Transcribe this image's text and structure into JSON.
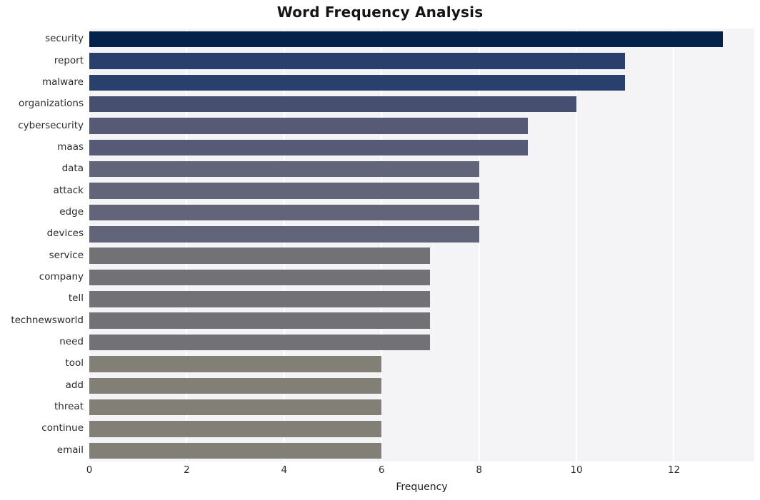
{
  "chart_data": {
    "type": "bar",
    "orientation": "horizontal",
    "title": "Word Frequency Analysis",
    "xlabel": "Frequency",
    "ylabel": "",
    "categories": [
      "security",
      "report",
      "malware",
      "organizations",
      "cybersecurity",
      "maas",
      "data",
      "attack",
      "edge",
      "devices",
      "service",
      "company",
      "tell",
      "technewsworld",
      "need",
      "tool",
      "add",
      "threat",
      "continue",
      "email"
    ],
    "values": [
      13,
      11,
      11,
      10,
      9,
      9,
      8,
      8,
      8,
      8,
      7,
      7,
      7,
      7,
      7,
      6,
      6,
      6,
      6,
      6
    ],
    "bar_colors": [
      "#04234a",
      "#293f6c",
      "#293f6c",
      "#474f70",
      "#565a76",
      "#565a76",
      "#62657a",
      "#62657a",
      "#62657a",
      "#62657a",
      "#727276",
      "#727276",
      "#727276",
      "#727276",
      "#727276",
      "#827f76",
      "#827f76",
      "#827f76",
      "#827f76",
      "#827f76"
    ],
    "xlim": [
      0,
      13.65
    ],
    "x_ticks": [
      0,
      2,
      4,
      6,
      8,
      10,
      12
    ],
    "x_tick_labels": [
      "0",
      "2",
      "4",
      "6",
      "8",
      "10",
      "12"
    ],
    "grid": true,
    "grid_axis": "x",
    "grid_color": "#ffffff",
    "plot_background": "#f4f4f6",
    "figure_background": "#ffffff",
    "legend": null
  }
}
